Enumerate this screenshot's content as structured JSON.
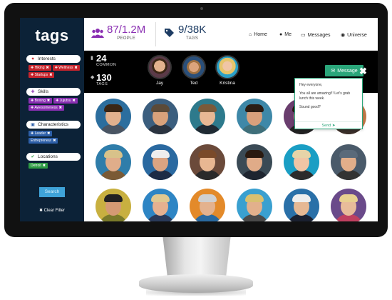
{
  "app": {
    "logo": "tags"
  },
  "header": {
    "people_count": "87/1.2M",
    "people_label": "PEOPLE",
    "tags_count": "9/38K",
    "tags_label": "TAGS",
    "nav": [
      {
        "label": "Home",
        "icon": "home-icon"
      },
      {
        "label": "Me",
        "icon": "user-icon"
      },
      {
        "label": "Messages",
        "icon": "inbox-icon"
      },
      {
        "label": "Universe",
        "icon": "globe-icon"
      }
    ],
    "colors": {
      "people": "#8a2fb2",
      "tags": "#1d3c63"
    }
  },
  "sidebar": {
    "groups": [
      {
        "title": "Interests",
        "icon": "heart-icon",
        "tags": [
          "Hiking",
          "Wellness",
          "Startups"
        ],
        "color": "#c7242c"
      },
      {
        "title": "Skills",
        "icon": "plus-circle-icon",
        "tags": [
          "Boxing",
          "Jujutsu",
          "Awesomeness"
        ],
        "color": "#8a2fb2"
      },
      {
        "title": "Characteristics",
        "icon": "user-card-icon",
        "tags": [
          "Leader",
          "Entrepreneur"
        ],
        "color": "#2d5fa8"
      },
      {
        "title": "Locations",
        "icon": "check-icon",
        "tags": [
          "Detroit"
        ],
        "color": "#2d9a43"
      }
    ],
    "search_label": "Search",
    "clear_label": "Clear Filter"
  },
  "common_bar": {
    "common_count": "24",
    "common_label": "COMMON",
    "tags_count": "130",
    "tags_label": "TAGS",
    "friends": [
      {
        "name": "Jay"
      },
      {
        "name": "Ted"
      },
      {
        "name": "Kristina"
      }
    ],
    "message_button": "Message"
  },
  "popup": {
    "line1": "Hey everyone,",
    "line2": "You all are amazing!!! Let's grab lunch this week.",
    "line3": "Sound good?",
    "send_label": "Send"
  },
  "grid": {
    "people": [
      {
        "bg": "#2c6e9e",
        "skin": "#e2b18e",
        "hair": "#3a2616",
        "shirt": "#4a5563"
      },
      {
        "bg": "#3b5e7e",
        "skin": "#d9a27b",
        "hair": "#5b4a38",
        "shirt": "#2b3440"
      },
      {
        "bg": "#2d7a8c",
        "skin": "#e8b894",
        "hair": "#7a5a3a",
        "shirt": "#1f2a33"
      },
      {
        "bg": "#3e88a8",
        "skin": "#d8a07c",
        "hair": "#2b1d14",
        "shirt": "#3f6f7a"
      },
      {
        "bg": "#6a3e6e",
        "skin": "#e4b090",
        "hair": "#2a1b12",
        "shirt": "#222"
      },
      {
        "bg": "#c27a4a",
        "skin": "#e6b795",
        "hair": "#2a3a55",
        "shirt": "#3a2f2a"
      },
      {
        "bg": "#2f7daa",
        "skin": "#e0ad8a",
        "hair": "#d8c28a",
        "shirt": "#7a5a35"
      },
      {
        "bg": "#2a69a0",
        "skin": "#dba482",
        "hair": "#eeeeee",
        "shirt": "#1c2b45"
      },
      {
        "bg": "#6b4a3a",
        "skin": "#e8b792",
        "hair": "#7a4a2a",
        "shirt": "#2a2a2a"
      },
      {
        "bg": "#3a4a55",
        "skin": "#e0ab88",
        "hair": "#2a1a10",
        "shirt": "#1e2530"
      },
      {
        "bg": "#1a9ec4",
        "skin": "#f0c5a5",
        "hair": "#e7d4a8",
        "shirt": "#2b2b2b"
      },
      {
        "bg": "#4a5a6a",
        "skin": "#e2ae8a",
        "hair": "#5a6a7a",
        "shirt": "#333"
      },
      {
        "bg": "#c8b040",
        "skin": "#d49a74",
        "hair": "#222",
        "shirt": "#7a7a2a"
      },
      {
        "bg": "#2e85c4",
        "skin": "#e6b190",
        "hair": "#e0c890",
        "shirt": "#2a3a5a"
      },
      {
        "bg": "#e38a2a",
        "skin": "#e4b28e",
        "hair": "#d0d0d0",
        "shirt": "#2a6aa0"
      },
      {
        "bg": "#3aa0d0",
        "skin": "#e2b08c",
        "hair": "#d8c070",
        "shirt": "#4a4a4a"
      },
      {
        "bg": "#2a70a8",
        "skin": "#e6b894",
        "hair": "#eeeeee",
        "shirt": "#1a2030"
      },
      {
        "bg": "#6a4a8a",
        "skin": "#e8bc9a",
        "hair": "#e8d090",
        "shirt": "#c04060"
      }
    ]
  }
}
